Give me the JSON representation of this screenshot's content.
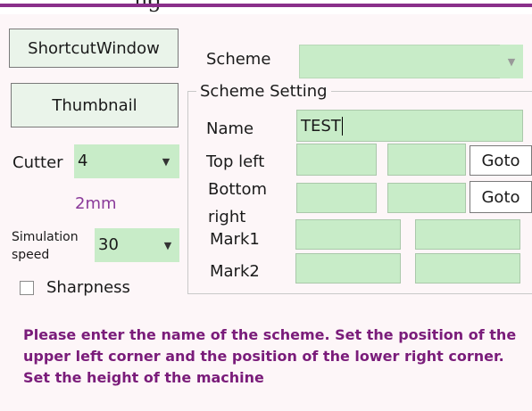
{
  "header_fragment": "ng",
  "buttons": {
    "shortcut": "ShortcutWindow",
    "thumbnail": "Thumbnail"
  },
  "cutter": {
    "label": "Cutter",
    "value": "4",
    "size": "2mm"
  },
  "simulation": {
    "label_line1": "Simulation",
    "label_line2": "speed",
    "value": "30"
  },
  "sharpness": {
    "label": "Sharpness",
    "checked": false
  },
  "scheme": {
    "label": "Scheme",
    "value": ""
  },
  "scheme_setting": {
    "title": "Scheme Setting",
    "name_label": "Name",
    "name_value": "TEST",
    "top_left_label": "Top left",
    "bottom_right_line1": "Bottom",
    "bottom_right_line2": "right",
    "mark1_label": "Mark1",
    "mark2_label": "Mark2",
    "goto_label": "Goto"
  },
  "message": "Please enter the name of the scheme. Set the position of the upper left corner and the position of the lower right corner. Set the height of the machine",
  "colors": {
    "field_bg": "#c8ecc8",
    "accent_line": "#8a2f8a",
    "message_text": "#7a1c7a",
    "size_text": "#8a3a9a"
  }
}
